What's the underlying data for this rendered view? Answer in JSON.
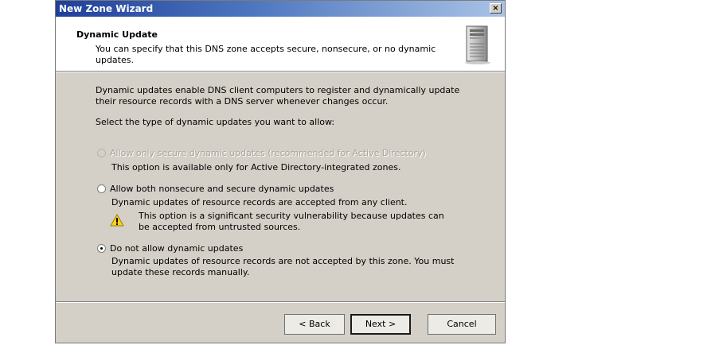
{
  "window": {
    "title": "New Zone Wizard",
    "close_label": "×"
  },
  "header": {
    "title": "Dynamic Update",
    "description": "You can specify that this DNS zone accepts secure, nonsecure, or no dynamic updates.",
    "icon": "server-icon"
  },
  "body": {
    "intro": "Dynamic updates enable DNS client computers to register and dynamically update their resource records with a DNS server whenever changes occur.",
    "prompt": "Select the type of dynamic updates you want to allow:"
  },
  "options": [
    {
      "label": "Allow only secure dynamic updates (recommended for Active Directory)",
      "description": "This option is available only for Active Directory-integrated zones.",
      "enabled": false,
      "selected": false
    },
    {
      "label": "Allow both nonsecure and secure dynamic updates",
      "description": "Dynamic updates of resource records are accepted from any client.",
      "enabled": true,
      "selected": false
    },
    {
      "label": "Do not allow dynamic updates",
      "description": "Dynamic updates of resource records are not accepted by this zone. You must update these records manually.",
      "enabled": true,
      "selected": true
    }
  ],
  "warning": {
    "icon": "warning-icon",
    "text": "This option is a significant security vulnerability because updates can be accepted from untrusted sources."
  },
  "buttons": {
    "back": "< Back",
    "next": "Next >",
    "cancel": "Cancel"
  }
}
